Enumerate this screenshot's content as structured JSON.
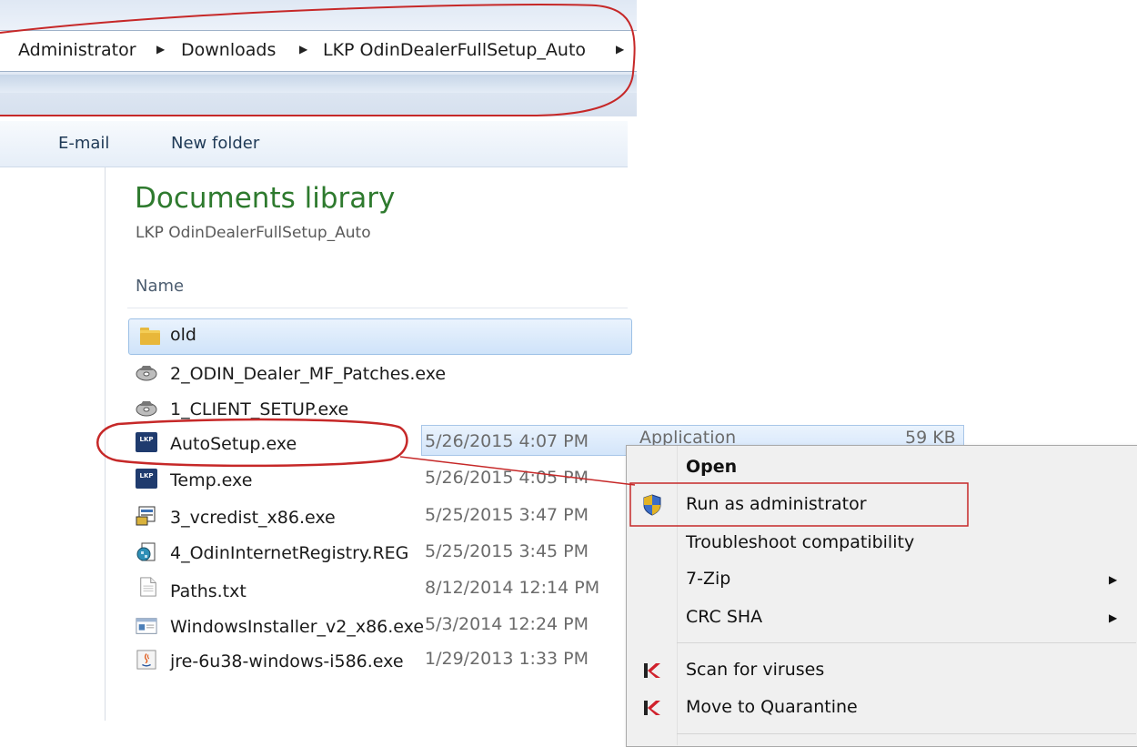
{
  "breadcrumb": {
    "items": [
      "Administrator",
      "Downloads",
      "LKP OdinDealerFullSetup_Auto"
    ]
  },
  "toolbar": {
    "email_label": "E-mail",
    "new_folder_label": "New folder"
  },
  "library": {
    "title": "Documents library",
    "subtitle": "LKP OdinDealerFullSetup_Auto",
    "column_name": "Name"
  },
  "files": [
    {
      "name": "old",
      "date": "",
      "icon": "folder-icon"
    },
    {
      "name": "2_ODIN_Dealer_MF_Patches.exe",
      "date": "",
      "icon": "installer-disc-icon"
    },
    {
      "name": "1_CLIENT_SETUP.exe",
      "date": "",
      "icon": "installer-disc-icon"
    },
    {
      "name": "AutoSetup.exe",
      "date": "5/26/2015 4:07 PM",
      "type": "Application",
      "size": "59 KB",
      "icon": "lkp-app-icon"
    },
    {
      "name": "Temp.exe",
      "date": "5/26/2015 4:05 PM",
      "icon": "lkp-app-icon"
    },
    {
      "name": "3_vcredist_x86.exe",
      "date": "5/25/2015 3:47 PM",
      "icon": "setup-icon"
    },
    {
      "name": "4_OdinInternetRegistry.REG",
      "date": "5/25/2015 3:45 PM",
      "icon": "registry-icon"
    },
    {
      "name": "Paths.txt",
      "date": "8/12/2014 12:14 PM",
      "icon": "text-file-icon"
    },
    {
      "name": "WindowsInstaller_v2_x86.exe",
      "date": "5/3/2014 12:24 PM",
      "icon": "window-app-icon"
    },
    {
      "name": "jre-6u38-windows-i586.exe",
      "date": "1/29/2013 1:33 PM",
      "icon": "java-icon"
    }
  ],
  "context_menu": {
    "items": [
      {
        "label": "Open",
        "bold": true
      },
      {
        "label": "Run as administrator",
        "icon": "uac-shield-icon"
      },
      {
        "label": "Troubleshoot compatibility"
      },
      {
        "label": "7-Zip",
        "submenu": true
      },
      {
        "label": "CRC SHA",
        "submenu": true
      },
      {
        "label": "Scan for viruses",
        "icon": "kaspersky-icon"
      },
      {
        "label": "Move to Quarantine",
        "icon": "kaspersky-icon"
      }
    ]
  },
  "annotation_color": "#d42b2b"
}
